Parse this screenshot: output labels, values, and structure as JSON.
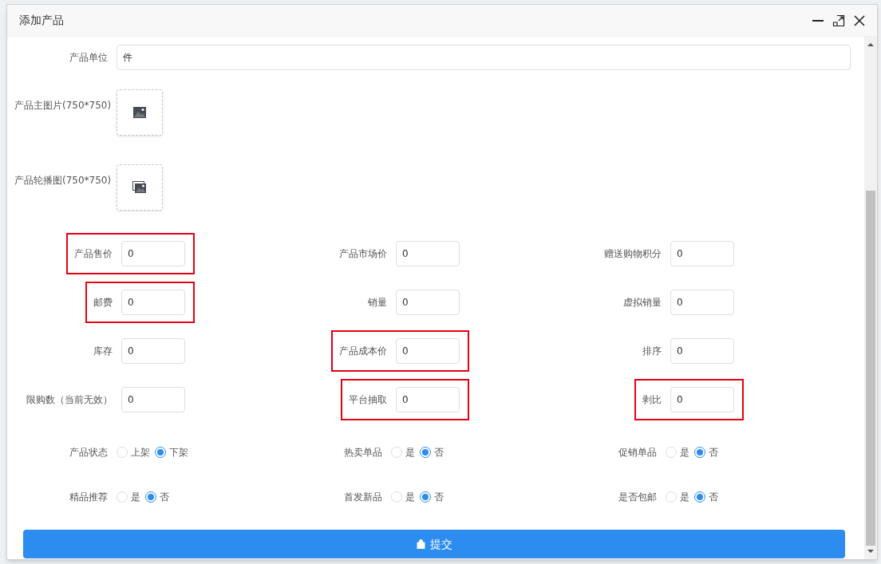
{
  "dialog": {
    "title": "添加产品"
  },
  "unit_field": {
    "label": "产品单位",
    "value": "件"
  },
  "uploads": [
    {
      "label": "产品主图片(750*750)",
      "kind": "single"
    },
    {
      "label": "产品轮播图(750*750)",
      "kind": "multiple"
    }
  ],
  "fields": [
    {
      "label": "产品售价",
      "value": "0",
      "highlighted": true
    },
    {
      "label": "产品市场价",
      "value": "0",
      "highlighted": false
    },
    {
      "label": "赠送购物积分",
      "value": "0",
      "highlighted": false
    },
    {
      "label": "邮费",
      "value": "0",
      "highlighted": true
    },
    {
      "label": "销量",
      "value": "0",
      "highlighted": false
    },
    {
      "label": "虚拟销量",
      "value": "0",
      "highlighted": false
    },
    {
      "label": "库存",
      "value": "0",
      "highlighted": false
    },
    {
      "label": "产品成本价",
      "value": "0",
      "highlighted": true
    },
    {
      "label": "排序",
      "value": "0",
      "highlighted": false
    },
    {
      "label": "限购数（当前无效）",
      "value": "0",
      "highlighted": false
    },
    {
      "label": "平台抽取",
      "value": "0",
      "highlighted": true
    },
    {
      "label": "剥比",
      "value": "0",
      "highlighted": true
    }
  ],
  "radio_groups": [
    {
      "label": "产品状态",
      "options": [
        {
          "label": "上架",
          "selected": false
        },
        {
          "label": "下架",
          "selected": true
        }
      ]
    },
    {
      "label": "热卖单品",
      "options": [
        {
          "label": "是",
          "selected": false
        },
        {
          "label": "否",
          "selected": true
        }
      ]
    },
    {
      "label": "促销单品",
      "options": [
        {
          "label": "是",
          "selected": false
        },
        {
          "label": "否",
          "selected": true
        }
      ]
    },
    {
      "label": "精品推荐",
      "options": [
        {
          "label": "是",
          "selected": false
        },
        {
          "label": "否",
          "selected": true
        }
      ]
    },
    {
      "label": "首发新品",
      "options": [
        {
          "label": "是",
          "selected": false
        },
        {
          "label": "否",
          "selected": true
        }
      ]
    },
    {
      "label": "是否包邮",
      "options": [
        {
          "label": "是",
          "selected": false
        },
        {
          "label": "否",
          "selected": true
        }
      ]
    }
  ],
  "submit": {
    "label": "提交"
  }
}
